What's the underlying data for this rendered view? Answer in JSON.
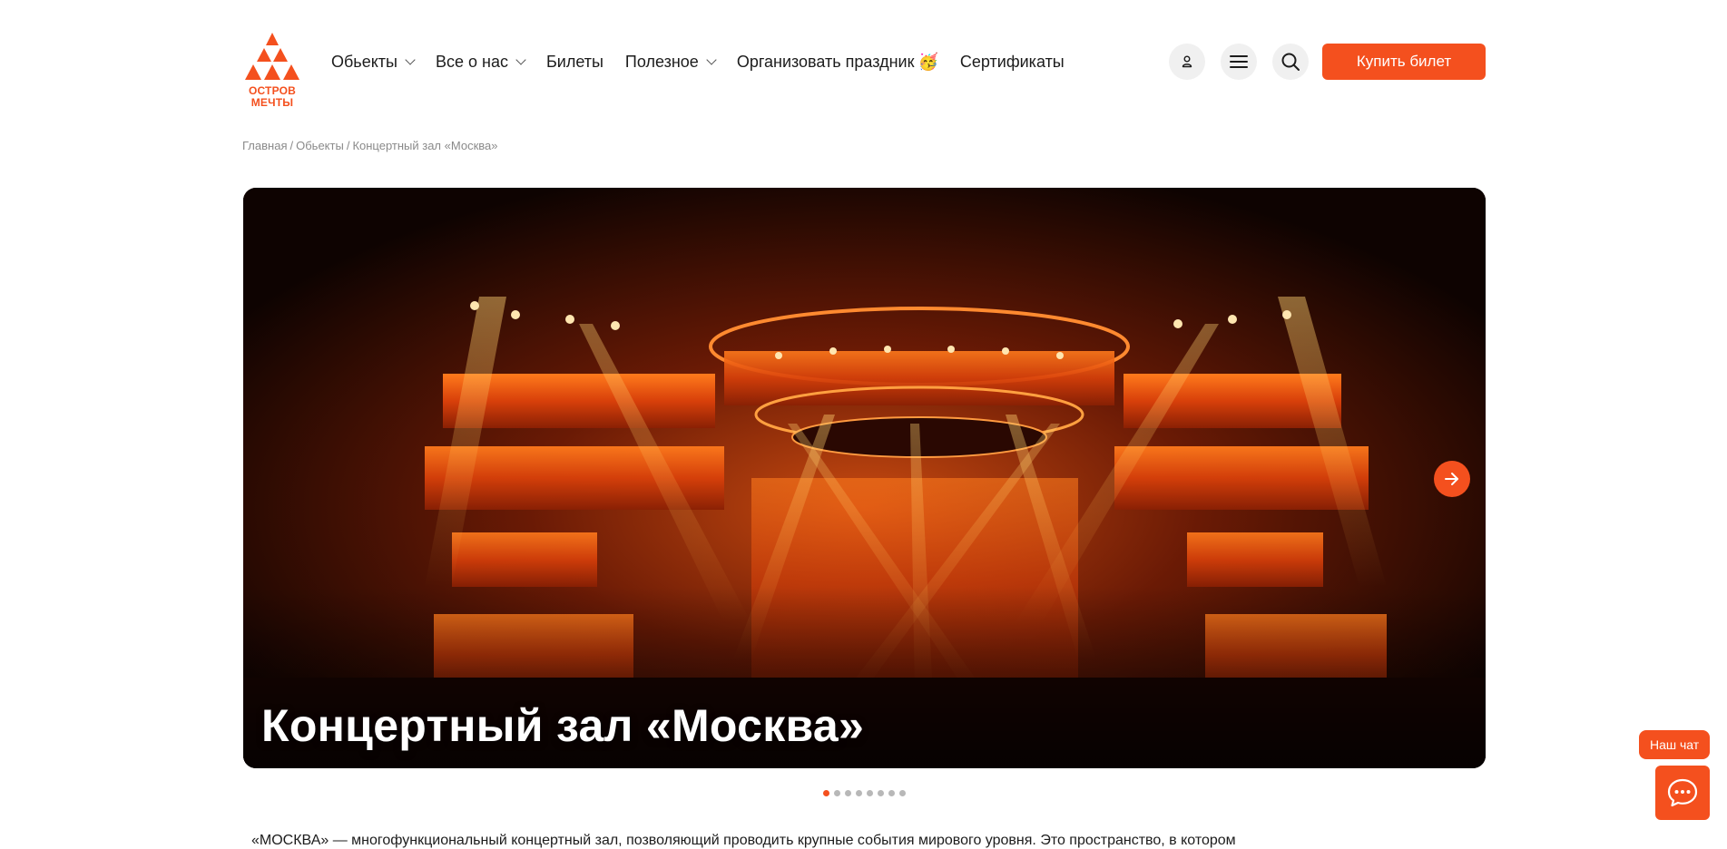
{
  "logo": {
    "line1": "ОСТРОВ",
    "line2": "МЕЧТЫ",
    "icon": "triangles-logo-icon"
  },
  "nav": {
    "items": [
      {
        "label": "Обьекты",
        "has_dropdown": true
      },
      {
        "label": "Все о нас",
        "has_dropdown": true
      },
      {
        "label": "Билеты",
        "has_dropdown": false
      },
      {
        "label": "Полезное",
        "has_dropdown": true
      },
      {
        "label": "Организовать праздник",
        "has_dropdown": false,
        "emoji": "🥳"
      },
      {
        "label": "Сертификаты",
        "has_dropdown": false
      }
    ]
  },
  "header_icons": [
    "user-icon",
    "menu-icon",
    "search-icon"
  ],
  "buy_button": {
    "label": "Купить билет"
  },
  "breadcrumb": {
    "items": [
      "Главная",
      "Обьекты",
      "Концертный зал «Москва»"
    ],
    "separator": "/"
  },
  "hero": {
    "title": "Концертный зал «Москва»",
    "slide_count": 8,
    "active_slide": 0
  },
  "body": {
    "intro_text": "«МОСКВА» — многофункциональный концертный зал, позволяющий проводить крупные события мирового уровня. Это пространство, в котором"
  },
  "chat": {
    "label": "Наш чат",
    "icon": "chat-bubble-icon"
  },
  "colors": {
    "accent": "#f4501e",
    "icon_bg": "#f0f0f0",
    "text": "#1c1c1c",
    "muted": "#8a8a8a"
  }
}
